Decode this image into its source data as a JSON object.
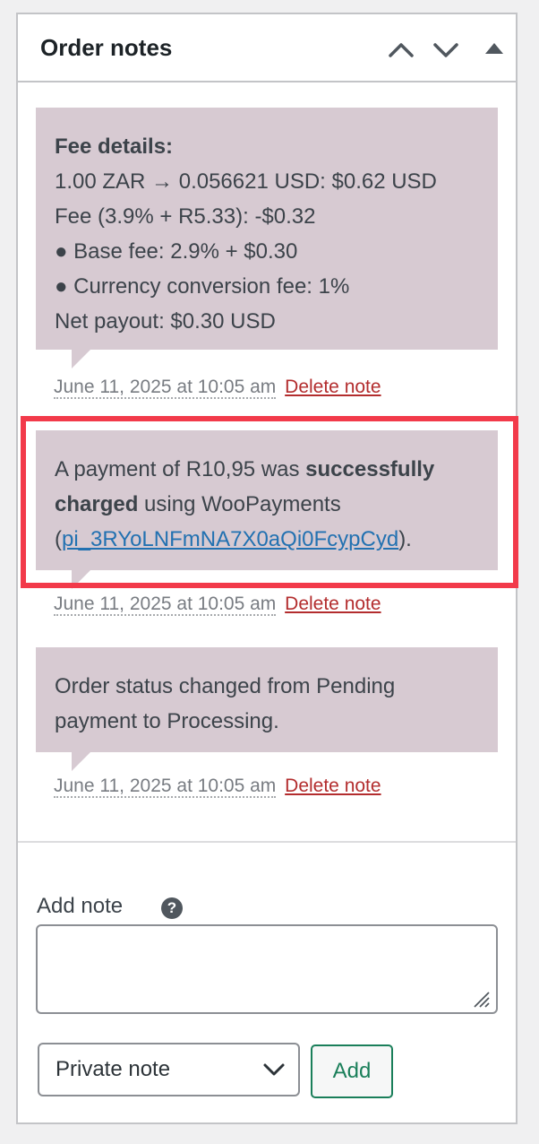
{
  "panel": {
    "title": "Order notes"
  },
  "notes": [
    {
      "line1": "Fee details:",
      "line2": "1.00 ZAR → 0.056621 USD: $0.62 USD",
      "line3": "Fee (3.9% + R5.33): -$0.32",
      "line4": "● Base fee: 2.9% + $0.30",
      "line5": "● Currency conversion fee: 1%",
      "line6": "Net payout: $0.30 USD",
      "date": "June 11, 2025 at 10:05 am",
      "delete_label": "Delete note"
    },
    {
      "text_a": "A payment of R10,95 was ",
      "text_bold": "successfully charged",
      "text_b": " using WooPayments (",
      "link": "pi_3RYoLNFmNA7X0aQi0FcypCyd",
      "text_c": ").",
      "date": "June 11, 2025 at 10:05 am",
      "delete_label": "Delete note"
    },
    {
      "text": "Order status changed from Pending payment to Processing.",
      "date": "June 11, 2025 at 10:05 am",
      "delete_label": "Delete note"
    }
  ],
  "add_note": {
    "label": "Add note",
    "help_icon": "?",
    "textarea_value": "",
    "note_type_selected": "Private note",
    "add_button": "Add"
  },
  "colors": {
    "note_bg": "#d7cad2",
    "highlight": "#f23a4a",
    "link": "#2271b1",
    "delete": "#b32d2e",
    "add_button": "#1a7f5a"
  }
}
